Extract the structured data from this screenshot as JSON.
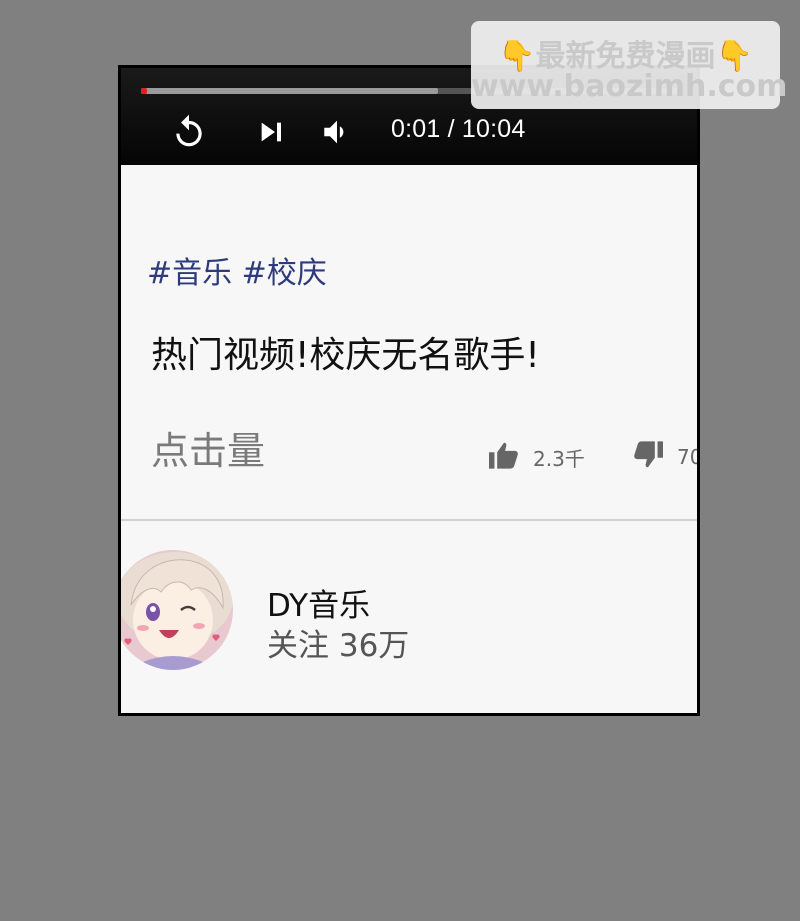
{
  "player": {
    "progress_played": 0.0017,
    "progress_buffered": 0.55,
    "time_display": "0:01 / 10:04",
    "icons": [
      "replay-icon",
      "skip-next-icon",
      "volume-icon"
    ]
  },
  "video": {
    "tags": "#音乐 #校庆",
    "title": "热门视频!校庆无名歌手!",
    "views_label": "点击量",
    "likes": "2.3千",
    "dislikes": "70"
  },
  "channel": {
    "name": "DY音乐",
    "subscribers": "关注 36万"
  },
  "watermark": {
    "hand_left": "👇",
    "line1": "最新免费漫画",
    "hand_right": "👇",
    "line2": "www.baozimh.com"
  },
  "colors": {
    "background": "#808080",
    "tag_color": "#2d3a7c",
    "progress_played": "#e02020",
    "watermark_text": "#c9c9c9"
  }
}
